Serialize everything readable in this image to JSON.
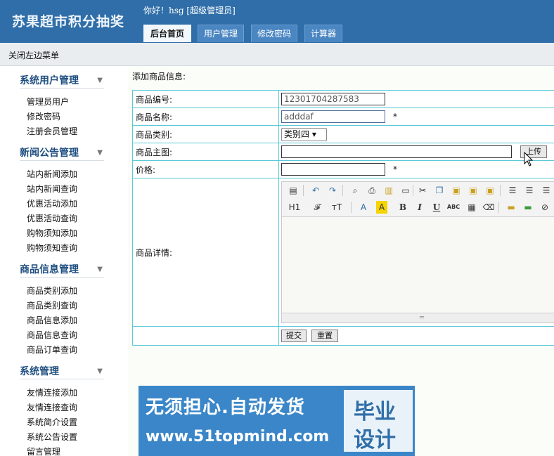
{
  "header": {
    "app_title": "苏果超市积分抽奖",
    "greeting": "你好！hsg [超级管理员]",
    "tabs": [
      {
        "label": "后台首页",
        "active": true
      },
      {
        "label": "用户管理",
        "active": false
      },
      {
        "label": "修改密码",
        "active": false
      },
      {
        "label": "计算器",
        "active": false
      }
    ]
  },
  "subbar": {
    "toggle_left_menu": "关闭左边菜单"
  },
  "sidebar": {
    "groups": [
      {
        "title": "系统用户管理",
        "items": [
          "管理员用户",
          "修改密码",
          "注册会员管理"
        ]
      },
      {
        "title": "新闻公告管理",
        "items": [
          "站内新闻添加",
          "站内新闻查询",
          "优惠活动添加",
          "优惠活动查询",
          "购物须知添加",
          "购物须知查询"
        ]
      },
      {
        "title": "商品信息管理",
        "items": [
          "商品类别添加",
          "商品类别查询",
          "商品信息添加",
          "商品信息查询",
          "商品订单查询"
        ]
      },
      {
        "title": "系统管理",
        "items": [
          "友情连接添加",
          "友情连接查询",
          "系统简介设置",
          "系统公告设置",
          "留言管理"
        ]
      }
    ],
    "arrow_glyph": "▼"
  },
  "form": {
    "heading": "添加商品信息:",
    "fields": {
      "code": {
        "label": "商品编号:",
        "value": "12301704287583"
      },
      "name": {
        "label": "商品名称:",
        "value": "adddaf",
        "required": "*"
      },
      "category": {
        "label": "商品类别:",
        "value": "类别四 ▾"
      },
      "image": {
        "label": "商品主图:",
        "value": "",
        "upload_label": "上传"
      },
      "price": {
        "label": "价格:",
        "value": "",
        "required": "*"
      },
      "detail": {
        "label": "商品详情:"
      }
    },
    "submit_label": "提交",
    "reset_label": "重置"
  },
  "editor": {
    "toolbar_row1": [
      "source-icon",
      "undo-icon",
      "redo-icon",
      "preview-icon",
      "print-icon",
      "template-icon",
      "code-icon",
      "cut-icon",
      "copy-icon",
      "paste-icon",
      "paste-text-icon",
      "paste-word-icon",
      "align-left-icon",
      "align-center-icon",
      "align-right-icon"
    ],
    "toolbar_row2_labels": {
      "heading": "H1",
      "font": "𝓕",
      "size": "тT",
      "font_color": "A",
      "highlight": "A",
      "bold": "B",
      "italic": "I",
      "underline": "U",
      "strike": "ABC"
    },
    "resize_glyph": "═"
  },
  "watermark": {
    "line1": "无须担心.自动发货",
    "line2": "www.51topmind.com",
    "box_line1": "毕业",
    "box_line2": "设计"
  },
  "colors": {
    "header_bg": "#2f6ea8",
    "table_border": "#5ac8d8",
    "menu_title": "#1f4f80"
  }
}
